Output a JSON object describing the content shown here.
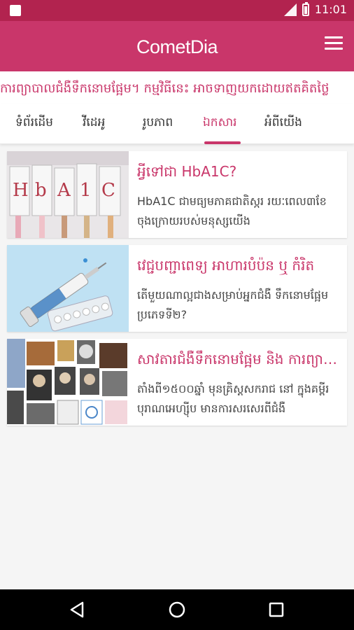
{
  "status_bar": {
    "time": "11:01",
    "network": "LTE"
  },
  "app_bar": {
    "logo_text": "CometDia",
    "logo_color": "#c9366a"
  },
  "ticker": {
    "text": "ការព្យាបាលជំងឺទឹកនោមផ្អែម។ កម្មវិធីនេះ អាចទាញយកដោយឥតគិតថ្លៃ"
  },
  "tabs": [
    {
      "label": "ទំព័រដើម"
    },
    {
      "label": "វីដេអូ"
    },
    {
      "label": "រូបភាព"
    },
    {
      "label": "ឯកសារ",
      "active": true
    },
    {
      "label": "អំពីយើង"
    }
  ],
  "articles": [
    {
      "title": "អ្វីទៅជា HbA1C?",
      "description": "HbA1C ជាមធ្យមភាគជាតិស្ករ រយៈពេល៣ខែចុងក្រោយរបស់មនុស្សយើង",
      "thumb_label": "HbA1C",
      "thumb_icon": "hba1c-blocks-image"
    },
    {
      "title": "វេជ្ជបញ្ជាពេទ្យ អាហារបំប៉ន ឬ កំរិត",
      "description": "តើមួយណាល្អជាងសម្រាប់អ្នកជំងឺ ទឹកនោមផ្អែម ប្រភេទទី២?",
      "thumb_icon": "syringe-pills-image"
    },
    {
      "title": "សាវតារជំងឺទឹកនោមផ្អែម និង ការព្យាបាល",
      "description": "តាំងពី១៥០០ឆ្នាំ មុនគ្រិស្តសករាជ នៅ ក្នុងគម្ពីរបុរាណអេហ្ស៊ីប មានការសរសេរពីជំងឺ",
      "thumb_icon": "history-collage-image"
    }
  ]
}
